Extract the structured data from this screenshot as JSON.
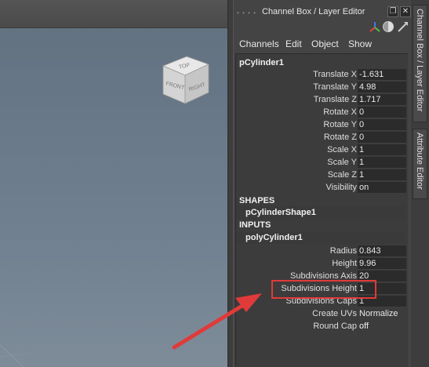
{
  "viewport": {
    "cube": {
      "top": "TOP",
      "front": "FRONT",
      "right": "RIGHT"
    }
  },
  "panel": {
    "title": "Channel Box / Layer Editor",
    "menus": [
      "Channels",
      "Edit",
      "Object",
      "Show"
    ],
    "node": "pCylinder1",
    "transform_attrs": [
      {
        "label": "Translate X",
        "value": "-1.631"
      },
      {
        "label": "Translate Y",
        "value": "4.98"
      },
      {
        "label": "Translate Z",
        "value": "1.717"
      },
      {
        "label": "Rotate X",
        "value": "0"
      },
      {
        "label": "Rotate Y",
        "value": "0"
      },
      {
        "label": "Rotate Z",
        "value": "0"
      },
      {
        "label": "Scale X",
        "value": "1"
      },
      {
        "label": "Scale Y",
        "value": "1"
      },
      {
        "label": "Scale Z",
        "value": "1"
      },
      {
        "label": "Visibility",
        "value": "on"
      }
    ],
    "shapes_header": "SHAPES",
    "shape_node": "pCylinderShape1",
    "inputs_header": "INPUTS",
    "input_node": "polyCylinder1",
    "input_attrs": [
      {
        "label": "Radius",
        "value": "0.843"
      },
      {
        "label": "Height",
        "value": "9.96"
      },
      {
        "label": "Subdivisions Axis",
        "value": "20"
      },
      {
        "label": "Subdivisions Height",
        "value": "1"
      },
      {
        "label": "Subdivisions Caps",
        "value": "1"
      },
      {
        "label": "Create UVs",
        "value": "Normalize ..."
      },
      {
        "label": "Round Cap",
        "value": "off"
      }
    ]
  },
  "side_tabs": [
    "Channel Box / Layer Editor",
    "Attribute Editor"
  ],
  "colors": {
    "highlight": "#e03a3a"
  }
}
